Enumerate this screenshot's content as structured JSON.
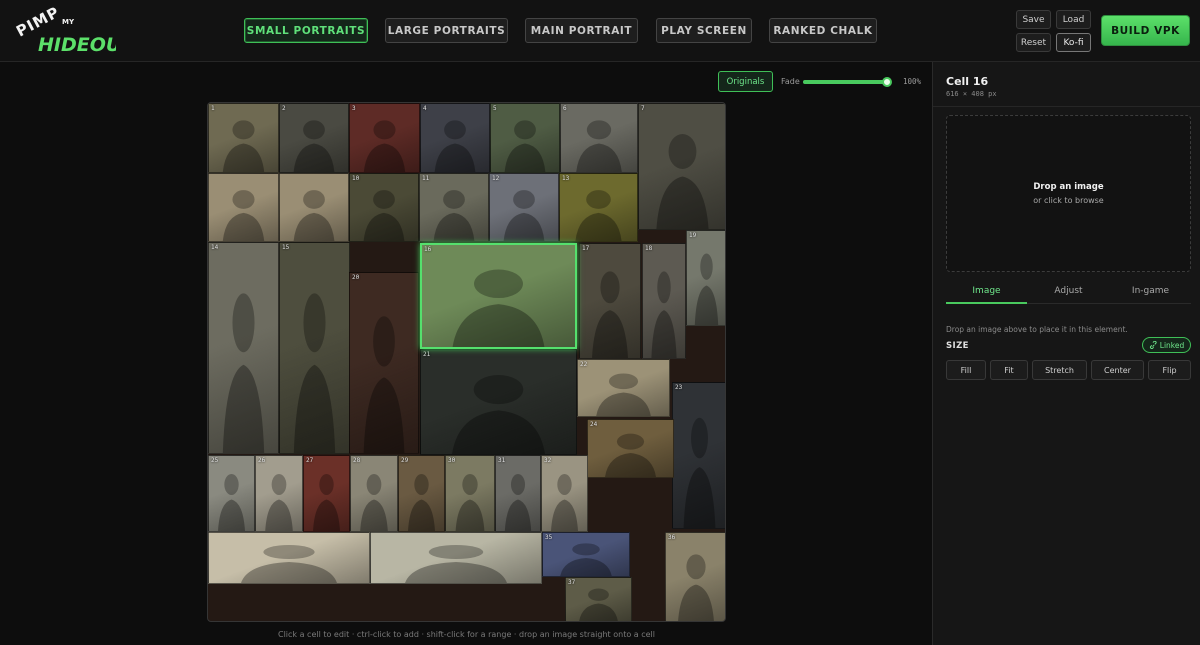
{
  "logo": {
    "line1": "PIMP",
    "small": "MY",
    "line2": "HIDEOUT"
  },
  "nav": [
    {
      "label": "SMALL PORTRAITS",
      "active": true
    },
    {
      "label": "LARGE PORTRAITS",
      "active": false
    },
    {
      "label": "MAIN PORTRAIT",
      "active": false
    },
    {
      "label": "PLAY SCREEN",
      "active": false
    },
    {
      "label": "RANKED CHALK",
      "active": false
    }
  ],
  "file_actions": {
    "save": "Save",
    "load": "Load",
    "reset": "Reset",
    "kofi": "Ko-fi"
  },
  "build_label": "BUILD VPK",
  "toolbar": {
    "originals": "Originals",
    "fade_label": "Fade",
    "fade_value_text": "100%",
    "fade_fraction": 1.0
  },
  "hint": "Click a cell to edit · ctrl-click to add · shift-click for a range · drop an image straight onto a cell",
  "cells": [
    {
      "num": "1",
      "color": "#6f6a52"
    },
    {
      "num": "2",
      "color": "#4a4a42"
    },
    {
      "num": "3",
      "color": "#5e2b26"
    },
    {
      "num": "4",
      "color": "#3e4048"
    },
    {
      "num": "5",
      "color": "#4f5c44"
    },
    {
      "num": "6",
      "color": "#6a6a62"
    },
    {
      "num": "7",
      "color": "#4f4e44"
    },
    {
      "num": "",
      "color": "#9a8e74"
    },
    {
      "num": "",
      "color": "#9a8e74"
    },
    {
      "num": "10",
      "color": "#4b4a36"
    },
    {
      "num": "11",
      "color": "#6a6a5c"
    },
    {
      "num": "12",
      "color": "#6d7078"
    },
    {
      "num": "13",
      "color": "#6d6a2e"
    },
    {
      "num": "14",
      "color": "#6d6c60"
    },
    {
      "num": "15",
      "color": "#4e4e3e"
    },
    {
      "num": "16",
      "color": "#6e8a58",
      "selected": true
    },
    {
      "num": "17",
      "color": "#4e4a3e"
    },
    {
      "num": "18",
      "color": "#5d5a52"
    },
    {
      "num": "19",
      "color": "#75786c"
    },
    {
      "num": "20",
      "color": "#3e2a22"
    },
    {
      "num": "21",
      "color": "#2a2e2a"
    },
    {
      "num": "22",
      "color": "#9c9277"
    },
    {
      "num": "23",
      "color": "#2f3236"
    },
    {
      "num": "24",
      "color": "#6f5e3e"
    },
    {
      "num": "25",
      "color": "#8a8a80"
    },
    {
      "num": "26",
      "color": "#a29d8e"
    },
    {
      "num": "27",
      "color": "#6b3028"
    },
    {
      "num": "28",
      "color": "#8a8676"
    },
    {
      "num": "29",
      "color": "#6a5a42"
    },
    {
      "num": "30",
      "color": "#7c7a62"
    },
    {
      "num": "31",
      "color": "#6b6b66"
    },
    {
      "num": "32",
      "color": "#9a9482"
    },
    {
      "num": "",
      "color": "#c6bea8"
    },
    {
      "num": "",
      "color": "#b8b6a4"
    },
    {
      "num": "35",
      "color": "#4a5478"
    },
    {
      "num": "36",
      "color": "#8a826a"
    },
    {
      "num": "37",
      "color": "#5e5c48"
    }
  ],
  "panel": {
    "title": "Cell 16",
    "size_text": "616 × 408 px",
    "drop_main": "Drop an image",
    "drop_sub": "or click to browse",
    "tabs": [
      {
        "label": "Image",
        "active": true
      },
      {
        "label": "Adjust",
        "active": false
      },
      {
        "label": "In-game",
        "active": false
      }
    ],
    "note": "Drop an image above to place it in this element.",
    "size_heading": "SIZE",
    "linked_label": "Linked",
    "link_icon": "link-icon",
    "size_options": [
      "Fill",
      "Fit",
      "Stretch",
      "Center",
      "Flip"
    ]
  }
}
